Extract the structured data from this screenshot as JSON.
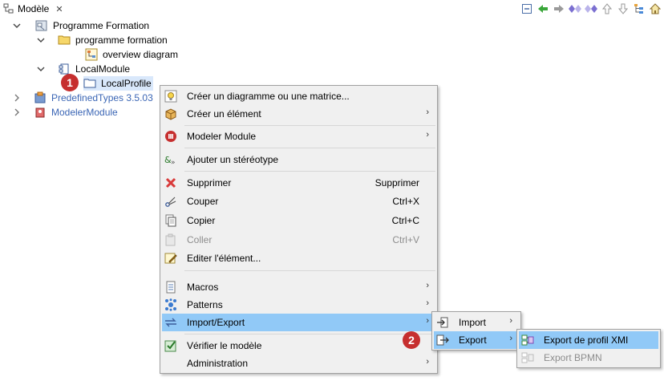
{
  "tab": {
    "title": "Modèle",
    "close_glyph": "✕"
  },
  "toolbar": {
    "icons": [
      "collapse-all-icon",
      "back-icon",
      "forward-icon",
      "link-diamond-icon",
      "link-diamond2-icon",
      "up-icon",
      "down-icon",
      "tree-icon",
      "home-icon"
    ]
  },
  "tree": {
    "programme_formation": "Programme Formation",
    "folder": "programme formation",
    "diagram": "overview diagram",
    "local_module": "LocalModule",
    "local_profile": "LocalProfile",
    "predefined_types": "PredefinedTypes 3.5.03",
    "modeler_module": "ModelerModule"
  },
  "badges": {
    "one": "1",
    "two": "2"
  },
  "context_menu": {
    "create_diagram": "Créer un diagramme ou une matrice...",
    "create_element": "Créer un élément",
    "modeler_module": "Modeler Module",
    "add_stereotype": "Ajouter un stéréotype",
    "delete": "Supprimer",
    "delete_key": "Supprimer",
    "cut": "Couper",
    "cut_key": "Ctrl+X",
    "copy": "Copier",
    "copy_key": "Ctrl+C",
    "paste": "Coller",
    "paste_key": "Ctrl+V",
    "edit": "Editer l'élément...",
    "macros": "Macros",
    "patterns": "Patterns",
    "import_export": "Import/Export",
    "verify": "Vérifier le modèle",
    "administration": "Administration"
  },
  "submenu1": {
    "import": "Import",
    "export": "Export"
  },
  "submenu2": {
    "export_xmi": "Export de profil XMI",
    "export_bpmn": "Export BPMN"
  },
  "colors": {
    "highlight": "#91c9f7",
    "badge": "#c62f2f",
    "tree_link": "#3b66b5"
  }
}
